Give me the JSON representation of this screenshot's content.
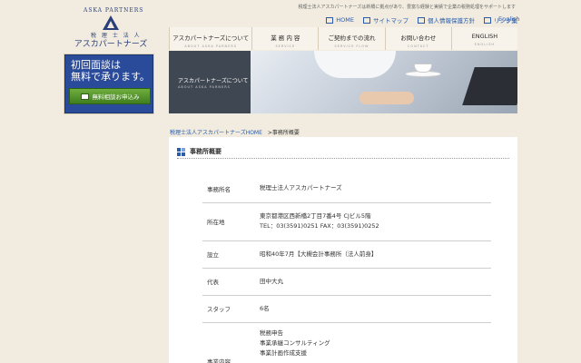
{
  "header": {
    "tagline": "税理士法人アスカパートナーズは新橋に拠点があり、豊富な経験と実績で企業の税務処理をサポートします",
    "logo": {
      "arc_text": "ASKA PARTNERS",
      "sub_text": "税 理 士 法 人",
      "name": "アスカパートナーズ"
    },
    "utility_links": [
      {
        "label": "HOME",
        "icon": "home-icon"
      },
      {
        "label": "サイトマップ",
        "icon": "sitemap-icon"
      },
      {
        "label": "個人情報保護方針",
        "icon": "person-icon"
      },
      {
        "label": "リンク集",
        "icon": "link-icon"
      }
    ],
    "english_link": "English"
  },
  "nav": {
    "items": [
      {
        "label": "アスカパートナーズについて",
        "en": "ABOUT ASKA PARNERS"
      },
      {
        "label": "業 務 内 容",
        "en": "SERVICE"
      },
      {
        "label": "ご契約までの流れ",
        "en": "SERVICE FLOW"
      },
      {
        "label": "お問い合わせ",
        "en": "CONTACT"
      },
      {
        "label": "ENGLISH",
        "en": "ENGLISH"
      }
    ]
  },
  "sidebar": {
    "banner_line1": "初回面談は",
    "banner_line2": "無料で承ります。",
    "consult_button": "無料相談お申込み"
  },
  "hero": {
    "title": "アスカパートナーズについて",
    "subtitle": "ABOUT ASKA PARNERS"
  },
  "breadcrumb": {
    "home": "税理士法人アスカパートナーズHOME",
    "current": ">事務所概要"
  },
  "main": {
    "section_title": "事務所概要",
    "rows": [
      {
        "label": "事務所名",
        "lines": [
          "税理士法人アスカパートナーズ"
        ]
      },
      {
        "label": "所在地",
        "lines": [
          "東京都港区西新橋2丁目7番4号 CJビル5階",
          "TEL：03(3591)0251 FAX：03(3591)0252"
        ]
      },
      {
        "label": "設立",
        "lines": [
          "昭和40年7月【大槻会計事務所（法人前身】"
        ]
      },
      {
        "label": "代表",
        "lines": [
          "田中大丸"
        ]
      },
      {
        "label": "スタッフ",
        "lines": [
          "6名"
        ]
      },
      {
        "label": "事業内容",
        "lines": [
          "税務申告",
          "事業承継コンサルティング",
          "事業計画作成支援"
        ]
      }
    ]
  },
  "colors": {
    "accent": "#2a5aa8",
    "brand": "#2a3f7a",
    "background": "#f1ecdf",
    "button_green": "#4f8f2a"
  }
}
